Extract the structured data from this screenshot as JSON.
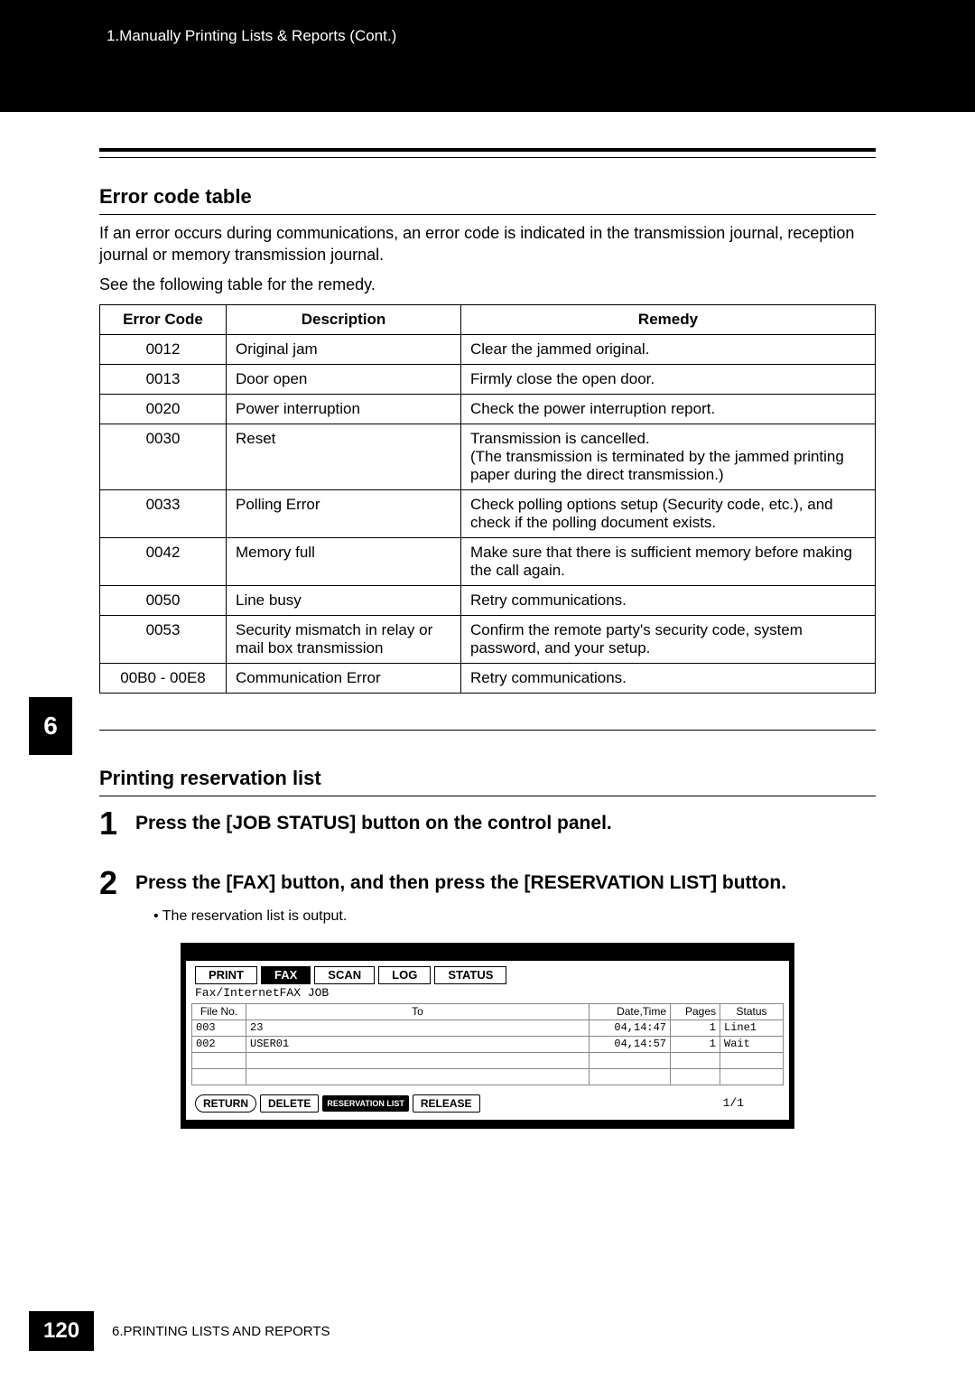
{
  "header": {
    "breadcrumb": "1.Manually Printing Lists & Reports (Cont.)"
  },
  "section1": {
    "title": "Error code table",
    "intro": "If an error occurs during communications, an error code is indicated in the transmission journal, reception journal or memory transmission journal.",
    "intro2": "See the following table for the remedy.",
    "headers": {
      "code": "Error Code",
      "desc": "Description",
      "remedy": "Remedy"
    },
    "rows": [
      {
        "code": "0012",
        "desc": "Original jam",
        "remedy": "Clear the jammed original."
      },
      {
        "code": "0013",
        "desc": "Door open",
        "remedy": "Firmly close the open door."
      },
      {
        "code": "0020",
        "desc": "Power interruption",
        "remedy": "Check the power interruption report."
      },
      {
        "code": "0030",
        "desc": "Reset",
        "remedy": "Transmission is cancelled.\n(The transmission is terminated by the jammed printing paper during the direct transmission.)"
      },
      {
        "code": "0033",
        "desc": "Polling Error",
        "remedy": "Check polling options setup (Security code, etc.), and check if the polling document exists."
      },
      {
        "code": "0042",
        "desc": "Memory full",
        "remedy": "Make sure that there is sufficient memory before making the call again."
      },
      {
        "code": "0050",
        "desc": "Line busy",
        "remedy": "Retry communications."
      },
      {
        "code": "0053",
        "desc": "Security mismatch in relay or mail box transmission",
        "remedy": "Confirm the remote party's security code, system password, and your setup."
      },
      {
        "code": "00B0 - 00E8",
        "desc": "Communication Error",
        "remedy": "Retry communications."
      }
    ]
  },
  "section2": {
    "title": "Printing reservation list",
    "steps": [
      {
        "num": "1",
        "text": "Press the [JOB STATUS] button on the control panel."
      },
      {
        "num": "2",
        "text": "Press the [FAX] button, and then press the [RESERVATION LIST] button."
      }
    ],
    "bullet": "The reservation list is output."
  },
  "screenshot": {
    "tabs": [
      "PRINT",
      "FAX",
      "SCAN",
      "LOG",
      "STATUS"
    ],
    "active_tab": "FAX",
    "subtitle": "Fax/InternetFAX JOB",
    "columns": {
      "fileno": "File No.",
      "to": "To",
      "datetime": "Date,Time",
      "pages": "Pages",
      "status": "Status"
    },
    "rows": [
      {
        "fileno": "003",
        "to": "23",
        "datetime": "04,14:47",
        "pages": "1",
        "status": "Line1"
      },
      {
        "fileno": "002",
        "to": "USER01",
        "datetime": "04,14:57",
        "pages": "1",
        "status": "Wait"
      },
      {
        "fileno": "",
        "to": "",
        "datetime": "",
        "pages": "",
        "status": ""
      },
      {
        "fileno": "",
        "to": "",
        "datetime": "",
        "pages": "",
        "status": ""
      }
    ],
    "buttons": {
      "return": "RETURN",
      "delete": "DELETE",
      "reslist": "RESERVATION LIST",
      "release": "RELEASE"
    },
    "page_indicator": "1/1"
  },
  "chapter_tab": "6",
  "footer": {
    "page_num": "120",
    "chapter": "6.PRINTING LISTS AND REPORTS"
  }
}
